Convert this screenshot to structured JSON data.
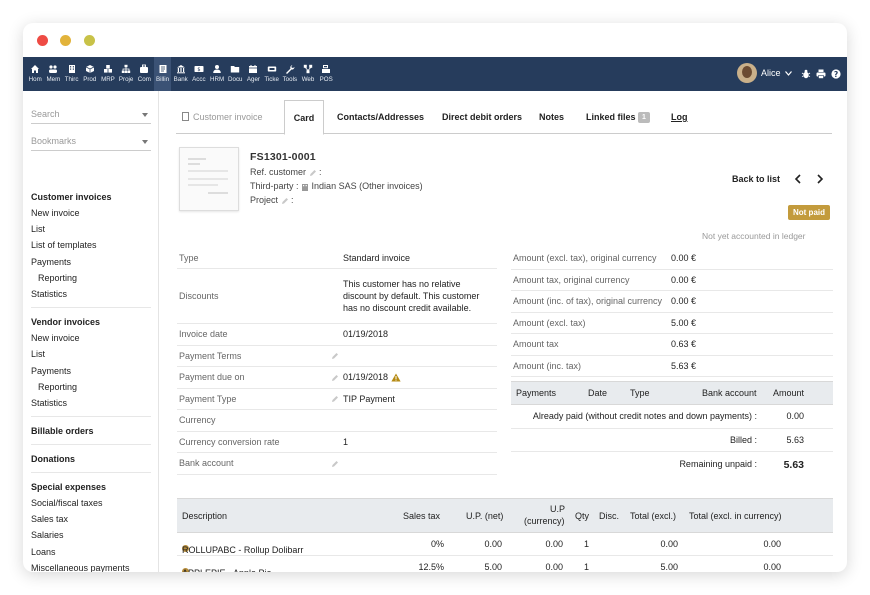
{
  "topbar": {
    "menu": [
      {
        "label": "Hom",
        "icon": "home-icon"
      },
      {
        "label": "Mem",
        "icon": "members-icon"
      },
      {
        "label": "Thirc",
        "icon": "building-icon"
      },
      {
        "label": "Prod",
        "icon": "box-icon"
      },
      {
        "label": "MRP",
        "icon": "cubes-icon"
      },
      {
        "label": "Proje",
        "icon": "sitemap-icon"
      },
      {
        "label": "Com",
        "icon": "suitcase-icon"
      },
      {
        "label": "Billin",
        "icon": "invoice-icon"
      },
      {
        "label": "Bank",
        "icon": "bank-icon"
      },
      {
        "label": "Accc",
        "icon": "dollar-icon"
      },
      {
        "label": "HRM",
        "icon": "user-icon"
      },
      {
        "label": "Docu",
        "icon": "folder-icon"
      },
      {
        "label": "Ager",
        "icon": "calendar-icon"
      },
      {
        "label": "Ticke",
        "icon": "ticket-icon"
      },
      {
        "label": "Tools",
        "icon": "wrench-icon"
      },
      {
        "label": "Web",
        "icon": "network-icon"
      },
      {
        "label": "POS",
        "icon": "cash-register-icon"
      }
    ],
    "active_index": 7,
    "user_name": "Alice",
    "right_icons": [
      "bug-icon",
      "print-icon",
      "help-icon"
    ]
  },
  "sidebar": {
    "search_placeholder": "Search",
    "bookmarks_placeholder": "Bookmarks",
    "groups": [
      {
        "title": "Customer invoices",
        "links": [
          {
            "label": "New invoice",
            "sub": false
          },
          {
            "label": "List",
            "sub": false
          },
          {
            "label": "List of templates",
            "sub": false
          },
          {
            "label": "Payments",
            "sub": false
          },
          {
            "label": "Reporting",
            "sub": true
          },
          {
            "label": "Statistics",
            "sub": false
          }
        ]
      },
      {
        "title": "Vendor invoices",
        "links": [
          {
            "label": "New invoice",
            "sub": false
          },
          {
            "label": "List",
            "sub": false
          },
          {
            "label": "Payments",
            "sub": false
          },
          {
            "label": "Reporting",
            "sub": true
          },
          {
            "label": "Statistics",
            "sub": false
          }
        ]
      },
      {
        "title": "Billable orders",
        "links": []
      },
      {
        "title": "Donations",
        "links": []
      },
      {
        "title": "Special expenses",
        "links": [
          {
            "label": "Social/fiscal taxes",
            "sub": false
          },
          {
            "label": "Sales tax",
            "sub": false
          },
          {
            "label": "Salaries",
            "sub": false
          },
          {
            "label": "Loans",
            "sub": false
          },
          {
            "label": "Miscellaneous payments",
            "sub": false
          }
        ]
      }
    ]
  },
  "tabs": {
    "customer_invoice": "Customer invoice",
    "card": "Card",
    "contacts": "Contacts/Addresses",
    "direct_debit": "Direct debit orders",
    "notes": "Notes",
    "linked_files": "Linked files",
    "linked_files_count": "1",
    "log": "Log"
  },
  "header": {
    "ref": "FS1301-0001",
    "ref_customer_label": "Ref. customer",
    "third_party_label": "Third-party :",
    "third_party_value": "Indian SAS (Other invoices)",
    "project_label": "Project",
    "back_to_list": "Back to list",
    "status": "Not paid",
    "ledger_note": "Not yet accounted in ledger"
  },
  "fields": [
    {
      "label": "Type",
      "value": "Standard invoice",
      "editable": false
    },
    {
      "label": "Discounts",
      "value": "This customer has no relative discount by default. This customer has no discount credit available.",
      "editable": false
    },
    {
      "label": "Invoice date",
      "value": "01/19/2018",
      "editable": false
    },
    {
      "label": "Payment Terms",
      "value": "",
      "editable": true
    },
    {
      "label": "Payment due on",
      "value": "01/19/2018",
      "editable": true,
      "warning": true
    },
    {
      "label": "Payment Type",
      "value": "TIP Payment",
      "editable": true
    },
    {
      "label": "Currency",
      "value": "",
      "editable": false
    },
    {
      "label": "Currency conversion rate",
      "value": "1",
      "editable": false
    },
    {
      "label": "Bank account",
      "value": "",
      "editable": true
    }
  ],
  "amounts": [
    {
      "label": "Amount (excl. tax), original currency",
      "value": "0.00 €"
    },
    {
      "label": "Amount tax, original currency",
      "value": "0.00 €"
    },
    {
      "label": "Amount (inc. of tax), original currency",
      "value": "0.00 €"
    },
    {
      "label": "Amount (excl. tax)",
      "value": "5.00 €"
    },
    {
      "label": "Amount tax",
      "value": "0.63 €"
    },
    {
      "label": "Amount (inc. tax)",
      "value": "5.63 €"
    }
  ],
  "payments": {
    "headers": {
      "payments": "Payments",
      "date": "Date",
      "type": "Type",
      "bank_account": "Bank account",
      "amount": "Amount"
    },
    "already_paid_label": "Already paid (without credit notes and down payments) :",
    "already_paid_value": "0.00",
    "billed_label": "Billed :",
    "billed_value": "5.63",
    "remaining_label": "Remaining unpaid :",
    "remaining_value": "5.63"
  },
  "lines": {
    "headers": {
      "description": "Description",
      "sales_tax": "Sales tax",
      "up_net": "U.P. (net)",
      "up_currency_1": "U.P",
      "up_currency_2": "(currency)",
      "qty": "Qty",
      "disc": "Disc.",
      "total_excl": "Total (excl.)",
      "total_currency": "Total (excl. in currency)"
    },
    "rows": [
      {
        "description": "ROLLUPABC - Rollup Dolibarr",
        "sales_tax": "0%",
        "up_net": "0.00",
        "up_currency": "0.00",
        "qty": "1",
        "disc": "",
        "total_excl": "0.00",
        "total_currency": "0.00"
      },
      {
        "description": "APPLEPIE - Apple Pie",
        "sales_tax": "12.5%",
        "up_net": "5.00",
        "up_currency": "0.00",
        "qty": "1",
        "disc": "",
        "total_excl": "5.00",
        "total_currency": "0.00"
      }
    ]
  },
  "colors": {
    "topbar": "#263c5c",
    "status_badge": "#c39b3c",
    "table_header": "#e8ebee"
  }
}
